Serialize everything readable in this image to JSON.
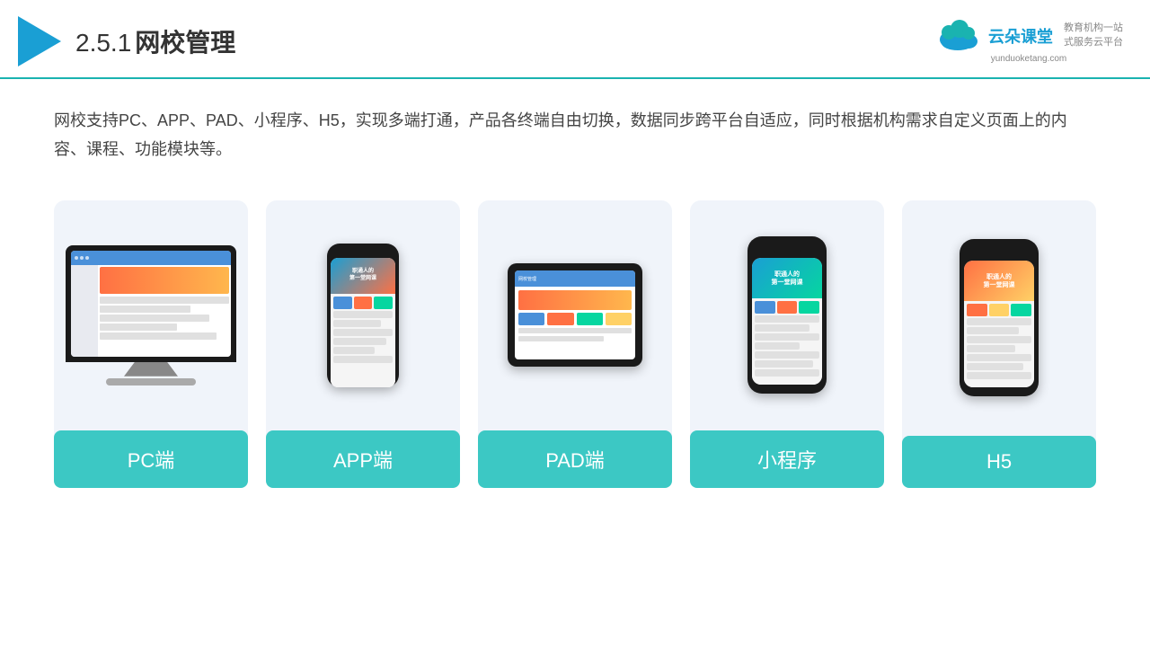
{
  "header": {
    "title": "2.5.1网校管理",
    "title_num": "2.5.1",
    "title_cn": "网校管理"
  },
  "brand": {
    "name": "云朵课堂",
    "url": "yunduoketang.com",
    "tagline_line1": "教育机构一站",
    "tagline_line2": "式服务云平台"
  },
  "description": "网校支持PC、APP、PAD、小程序、H5，实现多端打通，产品各终端自由切换，数据同步跨平台自适应，同时根据机构需求自定义页面上的内容、课程、功能模块等。",
  "cards": [
    {
      "id": "pc",
      "label": "PC端"
    },
    {
      "id": "app",
      "label": "APP端"
    },
    {
      "id": "pad",
      "label": "PAD端"
    },
    {
      "id": "miniprogram",
      "label": "小程序"
    },
    {
      "id": "h5",
      "label": "H5"
    }
  ]
}
